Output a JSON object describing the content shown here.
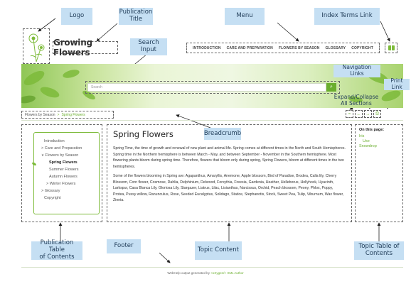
{
  "callouts": {
    "logo": "Logo",
    "publication_title": "Publication\nTitle",
    "menu": "Menu",
    "index_terms_link": "Index Terms Link",
    "search_input": "Search\nInput",
    "navigation_links": "Navigation Links",
    "print_link": "Print Link",
    "expand_collapse": "Expand/Collapse\nAll Sections",
    "breadcrumb": "Breadcrumb",
    "publication_toc": "Publication Table\nof Contents",
    "footer": "Footer",
    "topic_content": "Topic Content",
    "topic_toc": "Topic Table of\nContents"
  },
  "header": {
    "title": "Growing Flowers",
    "menu": [
      "INTRODUCTION",
      "CARE AND PREPARATION",
      "FLOWERS BY SEASON",
      "GLOSSARY",
      "COPYRIGHT"
    ],
    "index_icon": "book-icon"
  },
  "search": {
    "placeholder": "Search",
    "button_icon": "search-icon",
    "button_glyph": "⌕"
  },
  "breadcrumb": {
    "items": [
      "Flowers by Season",
      "Spring Flowers"
    ],
    "separator": ">"
  },
  "tools": {
    "expand_glyph": "≈",
    "prev_glyph": "←",
    "next_glyph": "→",
    "print_glyph": "⎙"
  },
  "publication_toc": {
    "items": [
      "Introduction",
      "> Care and Preparation",
      "∨ Flowers by Season",
      "Spring Flowers",
      "Summer Flowers",
      "Autumn Flowers",
      "> Winter Flowers",
      "> Glossary",
      "Copyright"
    ],
    "active_index": 3
  },
  "topic": {
    "title": "Spring Flowers",
    "paragraphs": [
      "Spring Time, the time of growth and renewal of new plant and animal life. Spring comes at different times in the North and South Hemispheres. Spring time in the Northern hemisphere is between March - May, and between September - November in the Southern hemisphere. Most flowering plants bloom during spring time. Therefore, flowers that bloom only during spring, Spring Flowers, bloom at different times in the two hemispheres.",
      "Some of the flowers blooming in Spring are: Agapanthus, Amaryllis, Anemone, Apple blossom, Bird of Paradise, Brodea, Calla lily, Cherry Blossom, Corn flower, Cosmose, Dahlia, Delphinium, Delwood, Forsythia, Freesia, Gardenia, Heather, Helleborus, Hollyhock, Hyacinth, Larkspur, Casa Blanca Lily, Gloriosa Lily, Stargazer, Liatrus, Lilac, Lisianthus, Narcissus, Orchid, Peach blossom, Peony, Phlox, Poppy, Protea, Pussy willow, Ranunculus, Rose, Seeded Eucalyptus, Solidago, Statice, Stephanotis, Stock, Sweet Pea, Tulip, Viburnum, Wax flower, Zinnia."
    ]
  },
  "topic_toc": {
    "title": "On this page:",
    "items": [
      "Iris",
      "Use",
      "Snowdrop"
    ]
  },
  "footer": {
    "prefix": "WebHelp output generated by ",
    "link": "<oXygen/> XML Author"
  },
  "colors": {
    "accent": "#6aae2e",
    "callout": "#c5dff3"
  }
}
